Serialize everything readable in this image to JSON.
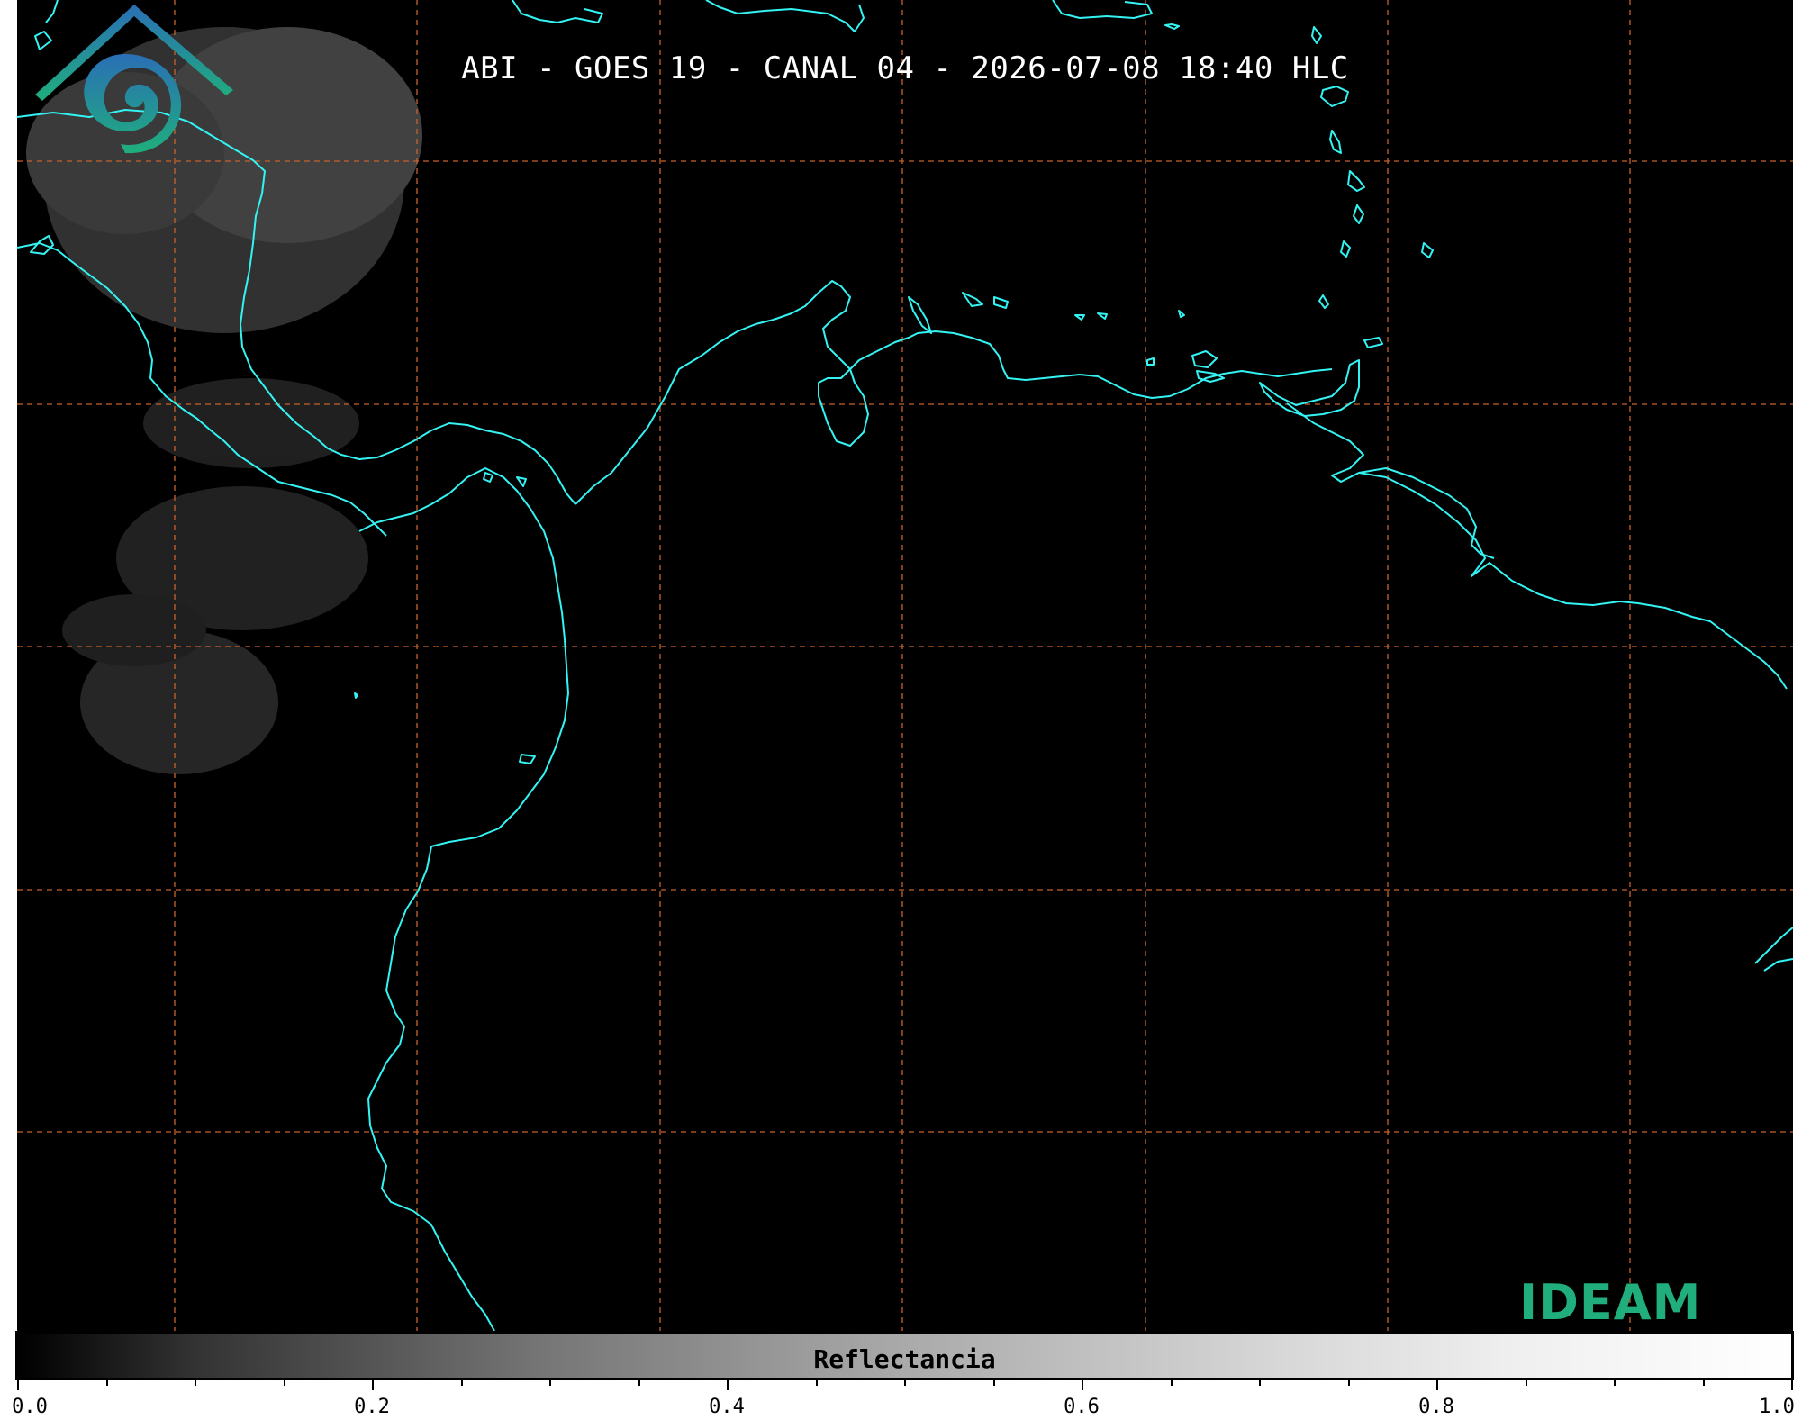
{
  "title": "ABI - GOES 19 - CANAL 04 - 2026-07-08 18:40 HLC",
  "logo": {
    "icon": "ideam-logo-icon",
    "text": "IDEAM"
  },
  "colorbar": {
    "label": "Reflectancia",
    "ticks": [
      "0.0",
      "0.2",
      "0.4",
      "0.6",
      "0.8",
      "1.0"
    ],
    "range": [
      0.0,
      1.0
    ],
    "colors": {
      "min": "#000000",
      "max": "#ffffff"
    }
  },
  "map": {
    "background": "#000000",
    "coastline_color": "#33f3f3",
    "gridline_color": "#c8622a",
    "gridline_style": "dashed"
  }
}
